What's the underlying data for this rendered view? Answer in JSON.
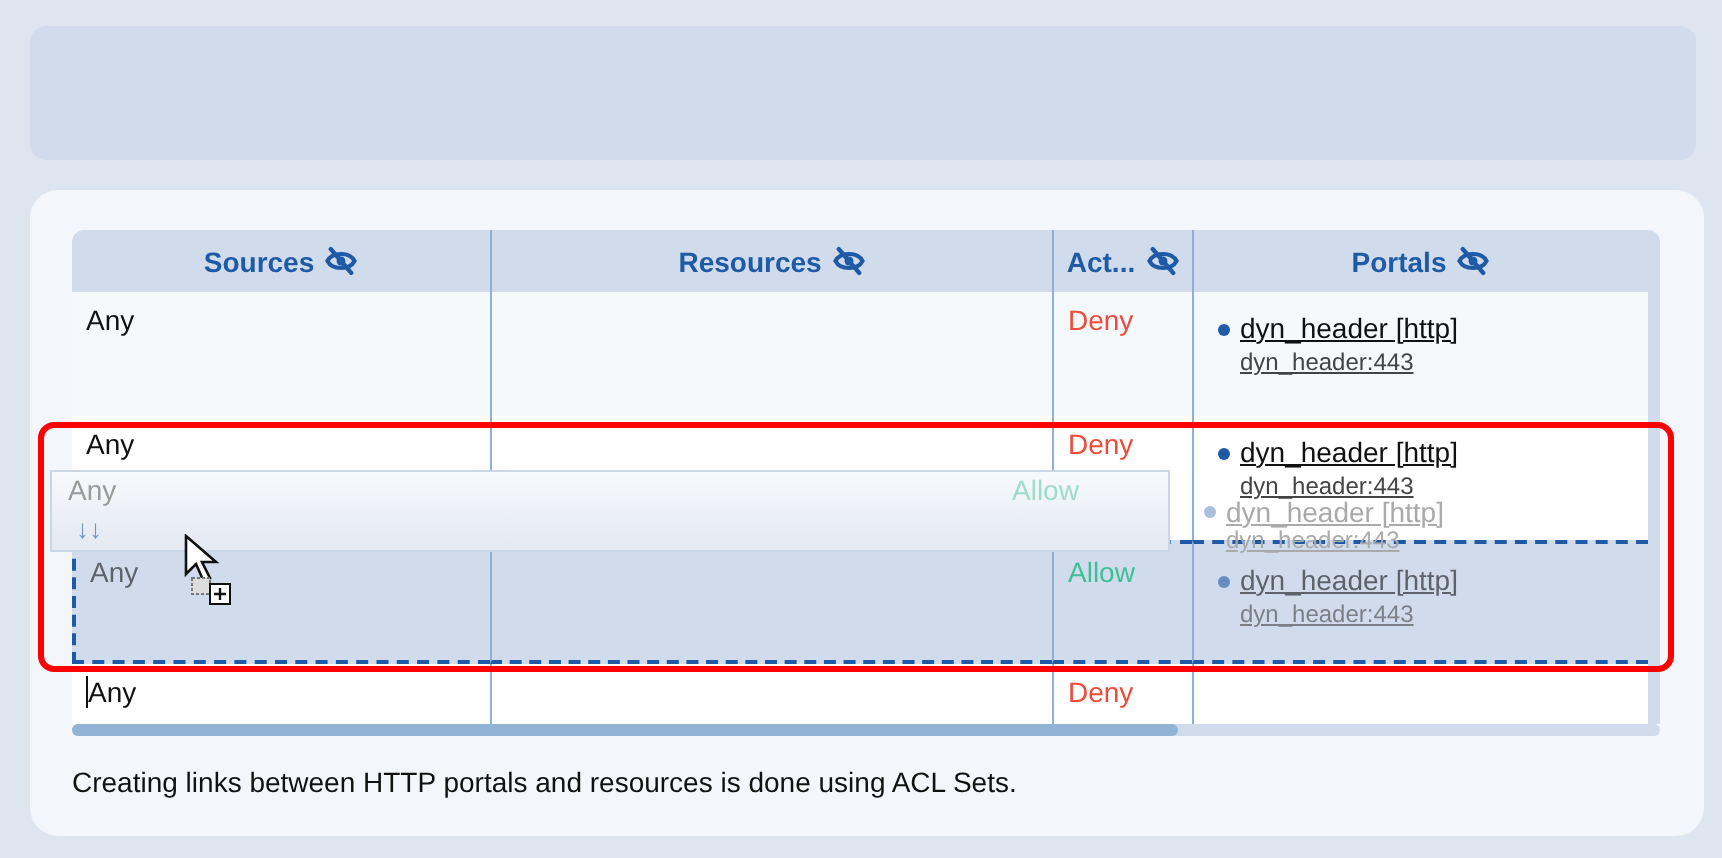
{
  "table": {
    "columns": [
      {
        "label": "Sources"
      },
      {
        "label": "Resources"
      },
      {
        "label": "Act..."
      },
      {
        "label": "Portals"
      }
    ],
    "rows": [
      {
        "source": "Any",
        "action": {
          "label": "Deny",
          "color": "#ef4a3a"
        },
        "portals": [
          {
            "name": "dyn_header [http]",
            "address": "dyn_header:443"
          }
        ],
        "drop_target": false,
        "text_cursor": false
      },
      {
        "source": "Any",
        "action": {
          "label": "Deny",
          "color": "#ef4a3a"
        },
        "portals": [
          {
            "name": "dyn_header [http]",
            "address": "dyn_header:443"
          }
        ],
        "drop_target": false,
        "text_cursor": false
      },
      {
        "source": "Any",
        "action": {
          "label": "Allow",
          "color": "#3fbf98"
        },
        "portals": [
          {
            "name": "dyn_header [http]",
            "address": "dyn_header:443"
          }
        ],
        "drop_target": true,
        "text_cursor": false
      },
      {
        "source": "Any",
        "action": {
          "label": "Deny",
          "color": "#ef4a3a"
        },
        "portals": [],
        "drop_target": false,
        "text_cursor": true
      }
    ],
    "drag_preview": {
      "source": "Any",
      "arrows": "↓↓",
      "action": "Allow",
      "portal": {
        "name": "dyn_header [http]",
        "address": "dyn_header:443"
      }
    }
  },
  "note": "Creating links between HTTP portals and resources is done using ACL Sets."
}
